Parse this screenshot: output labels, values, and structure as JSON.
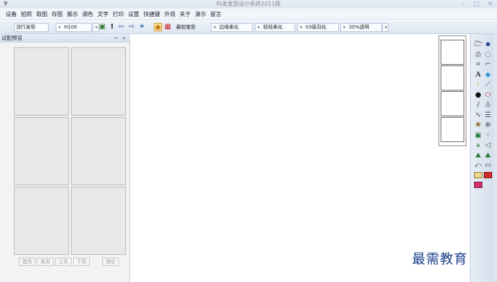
{
  "window": {
    "title": "科发发型设计系统2011版",
    "controls": [
      "–",
      "□",
      "✕"
    ]
  },
  "menu": [
    "设备",
    "拍照",
    "取图",
    "存图",
    "展示",
    "调色",
    "文字",
    "打印",
    "设置",
    "快捷键",
    "外观",
    "关于",
    "演示",
    "留言"
  ],
  "toolbar": {
    "hairstyle_select": "流行发型",
    "code_select": "H100",
    "pen_select": "最软笔型",
    "edge_select": "边缘柔化",
    "soft_select": "轻轻柔化",
    "feather_select": "03级羽化",
    "opacity_select": "30%透明"
  },
  "panel": {
    "title": "试配预览",
    "pin": "ꟷ",
    "close": "×"
  },
  "pager": {
    "first": "首页",
    "last": "末页",
    "prev": "上页",
    "next": "下页",
    "clear": "清空"
  },
  "watermark": "最需教育",
  "colors": {
    "swatch_yellow": "#f0d98a",
    "swatch_red": "#d42a2a",
    "swatch_pink": "#d0306a"
  }
}
